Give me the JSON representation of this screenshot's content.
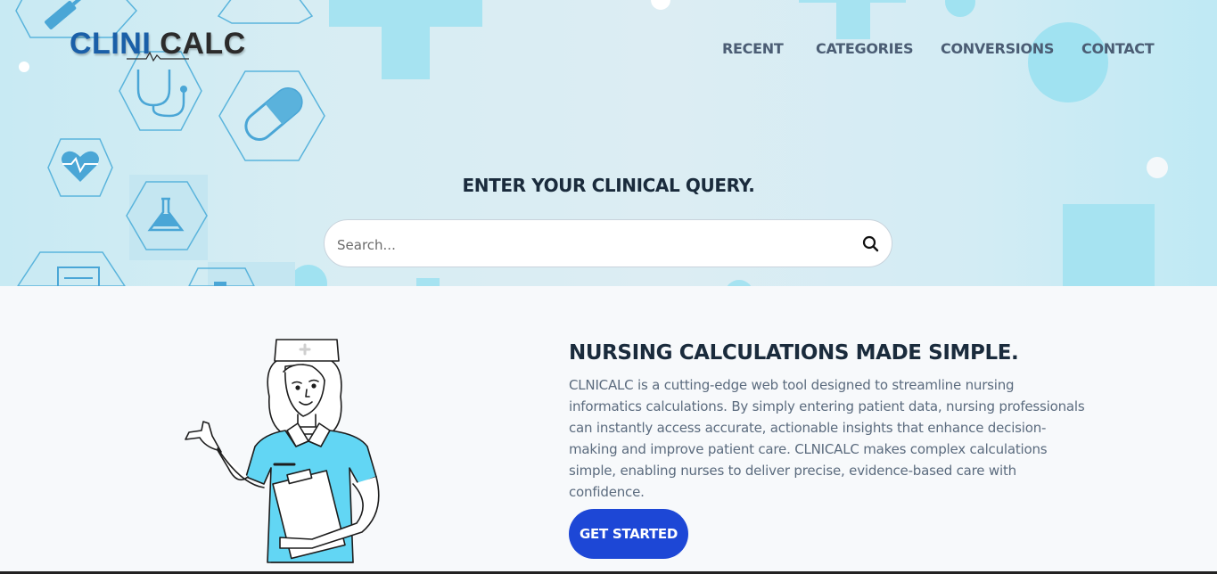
{
  "brand": {
    "logo_part1": "CLINI",
    "logo_part2": "CALC",
    "primary_color": "#1a5fa8",
    "accent_color": "#1d47d6"
  },
  "nav": {
    "items": [
      {
        "label": "RECENT"
      },
      {
        "label": "CATEGORIES"
      },
      {
        "label": "CONVERSIONS"
      },
      {
        "label": "CONTACT"
      }
    ]
  },
  "hero": {
    "title": "ENTER YOUR CLINICAL QUERY.",
    "search": {
      "placeholder": "Search...",
      "value": "",
      "icon": "search-icon"
    }
  },
  "feature": {
    "title": "NURSING CALCULATIONS MADE SIMPLE.",
    "body": "CLNICALC is a cutting-edge web tool designed to streamline nursing informatics calculations. By simply entering patient data, nursing professionals can instantly access accurate, actionable insights that enhance decision-making and improve patient care. CLNICALC makes complex calculations simple, enabling nurses to deliver precise, evidence-based care with confidence.",
    "cta_label": "GET STARTED"
  }
}
